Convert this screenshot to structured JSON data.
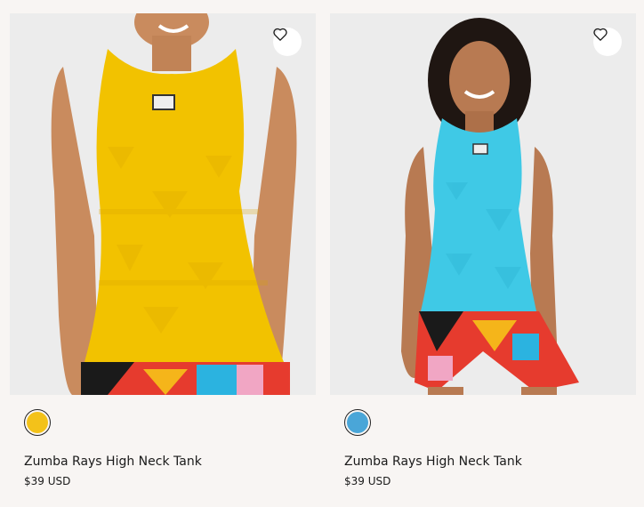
{
  "products": [
    {
      "title": "Zumba Rays High Neck Tank",
      "price": "$39 USD",
      "swatch_color": "#f3c21a",
      "image_desc_colors": {
        "top": "#f2c200",
        "skin": "#c98b5e",
        "bg": "#ececec"
      }
    },
    {
      "title": "Zumba Rays High Neck Tank",
      "price": "$39 USD",
      "swatch_color": "#4aa6d8",
      "image_desc_colors": {
        "top": "#3fc9e6",
        "skin": "#b87a52",
        "bg": "#ececec"
      }
    }
  ],
  "icons": {
    "wishlist": "heart-icon"
  }
}
